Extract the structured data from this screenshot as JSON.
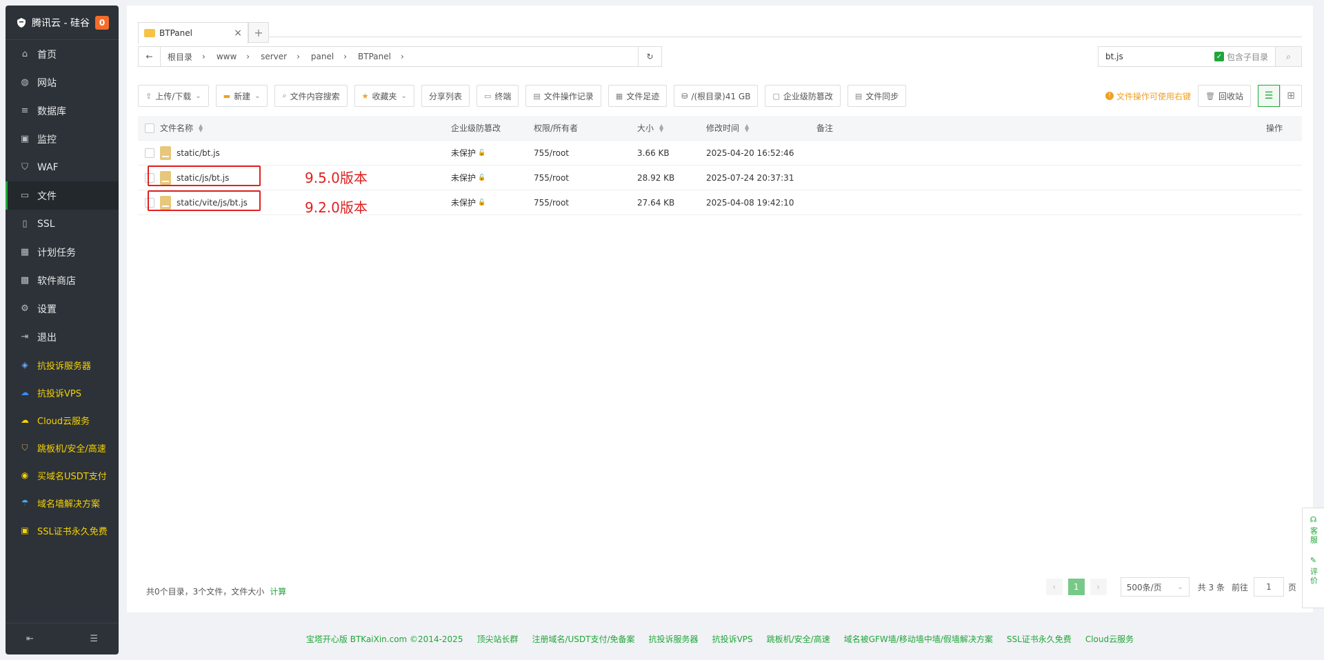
{
  "sidebar": {
    "brand": "腾讯云 - 硅谷",
    "badge": "0",
    "items": [
      {
        "label": "首页",
        "icon": "home-icon",
        "glyph": "⌂",
        "active": false
      },
      {
        "label": "网站",
        "icon": "globe-icon",
        "glyph": "◍",
        "active": false
      },
      {
        "label": "数据库",
        "icon": "database-icon",
        "glyph": "≡",
        "active": false
      },
      {
        "label": "监控",
        "icon": "monitor-icon",
        "glyph": "▣",
        "active": false
      },
      {
        "label": "WAF",
        "icon": "shield-icon",
        "glyph": "⛉",
        "active": false
      },
      {
        "label": "文件",
        "icon": "folder-icon",
        "glyph": "▭",
        "active": true
      },
      {
        "label": "SSL",
        "icon": "certificate-icon",
        "glyph": "▯",
        "active": false
      },
      {
        "label": "计划任务",
        "icon": "calendar-icon",
        "glyph": "▦",
        "active": false
      },
      {
        "label": "软件商店",
        "icon": "apps-icon",
        "glyph": "▩",
        "active": false
      },
      {
        "label": "设置",
        "icon": "gear-icon",
        "glyph": "⚙",
        "active": false
      },
      {
        "label": "退出",
        "icon": "logout-icon",
        "glyph": "⇥",
        "active": false
      }
    ],
    "promos": [
      {
        "label": "抗投诉服务器",
        "icon": "stack-icon",
        "glyph": "◈"
      },
      {
        "label": "抗投诉VPS",
        "icon": "cloud-icon",
        "glyph": "☁"
      },
      {
        "label": "Cloud云服务",
        "icon": "cloud-icon",
        "glyph": "☁"
      },
      {
        "label": "跳板机/安全/高速",
        "icon": "shield-icon",
        "glyph": "⛉"
      },
      {
        "label": "买域名USDT支付",
        "icon": "www-icon",
        "glyph": "◉"
      },
      {
        "label": "域名墙解决方案",
        "icon": "umbrella-icon",
        "glyph": "☂"
      },
      {
        "label": "SSL证书永久免费",
        "icon": "ssl-icon",
        "glyph": "▣"
      }
    ]
  },
  "tab": {
    "label": "BTPanel"
  },
  "path": {
    "crumbs": [
      "根目录",
      "www",
      "server",
      "panel",
      "BTPanel"
    ]
  },
  "search": {
    "value": "bt.js",
    "subdir_label": "包含子目录"
  },
  "toolbar": {
    "upload": "上传/下载",
    "new": "新建",
    "content_search": "文件内容搜索",
    "favorites": "收藏夹",
    "share_list": "分享列表",
    "terminal": "终端",
    "op_log": "文件操作记录",
    "footprint": "文件足迹",
    "disk": "/(根目录)41 GB",
    "tamper": "企业级防篡改",
    "sync": "文件同步",
    "tip": "文件操作可使用右键",
    "recycle": "回收站"
  },
  "table": {
    "headers": {
      "name": "文件名称",
      "protect": "企业级防篡改",
      "perm": "权限/所有者",
      "size": "大小",
      "mtime": "修改时间",
      "note": "备注",
      "ops": "操作"
    },
    "rows": [
      {
        "name": "static/bt.js",
        "protect": "未保护",
        "perm": "755/root",
        "size": "3.66 KB",
        "mtime": "2025-04-20 16:52:46"
      },
      {
        "name": "static/js/bt.js",
        "protect": "未保护",
        "perm": "755/root",
        "size": "28.92 KB",
        "mtime": "2025-07-24 20:37:31"
      },
      {
        "name": "static/vite/js/bt.js",
        "protect": "未保护",
        "perm": "755/root",
        "size": "27.64 KB",
        "mtime": "2025-04-08 19:42:10"
      }
    ]
  },
  "annotations": {
    "row2": "9.5.0版本",
    "row3": "9.2.0版本"
  },
  "footer": {
    "summary": "共0个目录，3个文件，文件大小",
    "calc": "计算",
    "page": "1",
    "page_size": "500条/页",
    "total": "共 3 条",
    "goto": "前往",
    "goto_value": "1",
    "page_suffix": "页"
  },
  "float": {
    "service": "客服",
    "review": "评价"
  },
  "bottom_links": [
    "宝塔开心版 BTKaiXin.com ©2014-2025",
    "顶尖站长群",
    "注册域名/USDT支付/免备案",
    "抗投诉服务器",
    "抗投诉VPS",
    "跳板机/安全/高速",
    "域名被GFW墙/移动墙中墙/假墙解决方案",
    "SSL证书永久免费",
    "Cloud云服务"
  ]
}
